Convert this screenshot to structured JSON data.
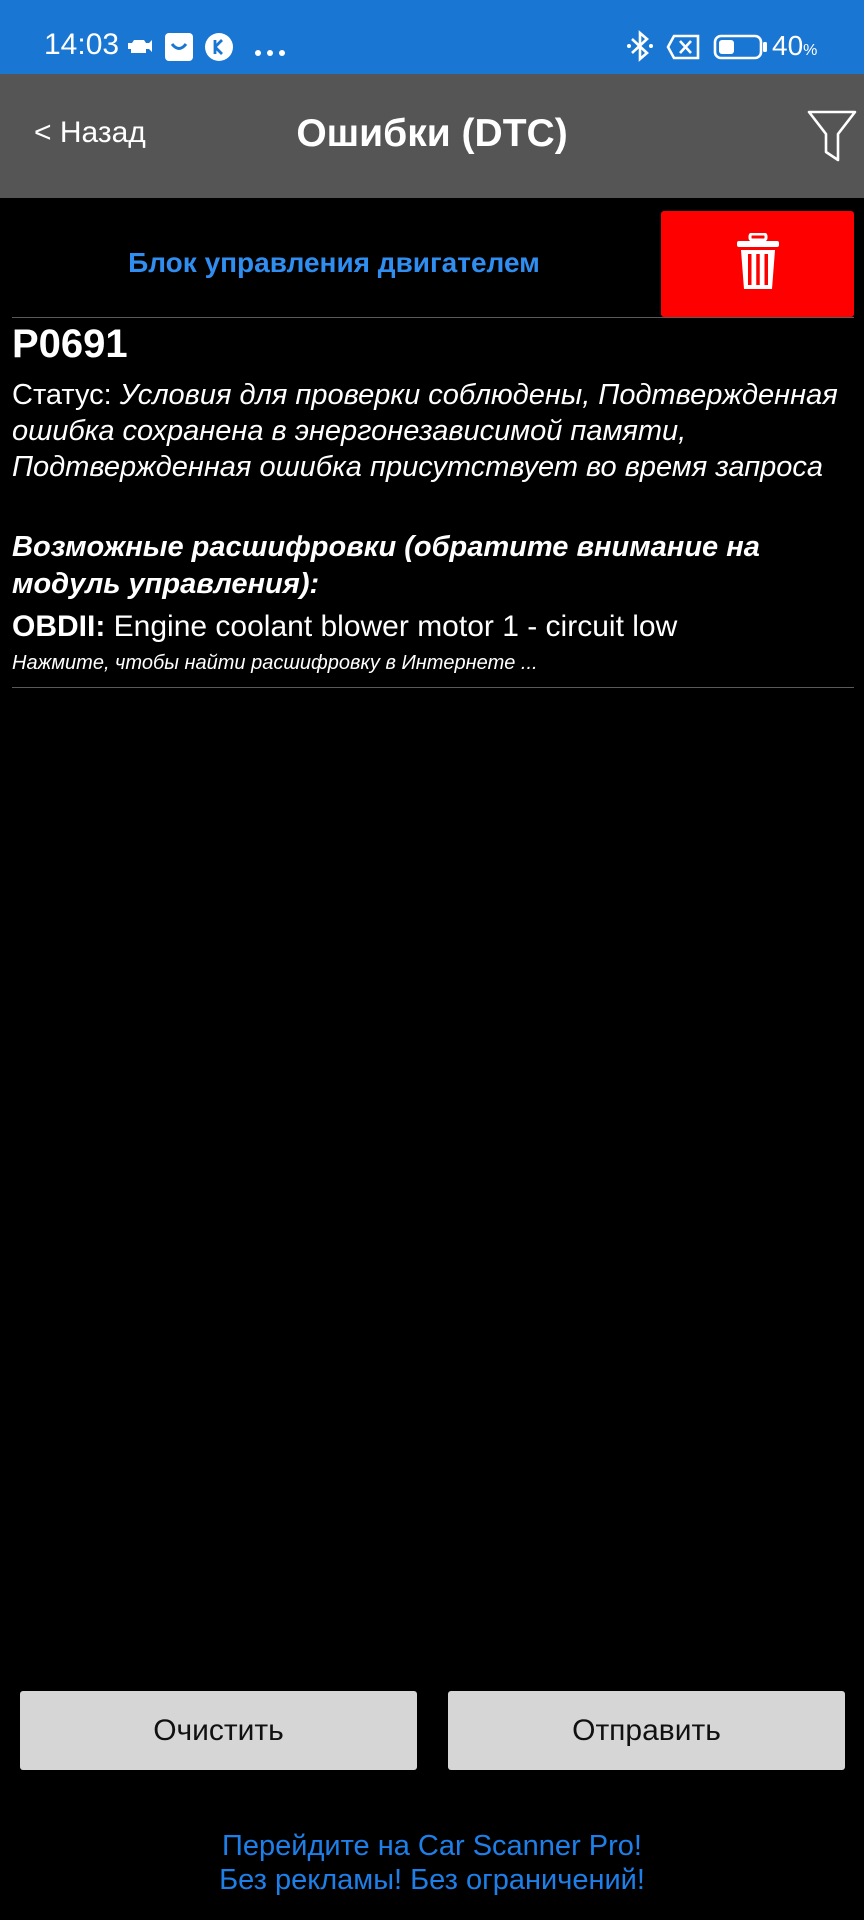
{
  "status_bar": {
    "time": "14:03",
    "battery_percent": "40",
    "battery_unit": "%",
    "battery_level": 0.4,
    "icons": [
      "car-icon",
      "message-app-icon",
      "k-app-icon",
      "more-dots-icon",
      "bluetooth-icon",
      "sim-off-icon",
      "battery-icon"
    ]
  },
  "navbar": {
    "back_label": "< Назад",
    "title": "Ошибки (DTC)",
    "filter_icon": "filter-icon"
  },
  "module": {
    "name": "Блок управления двигателем",
    "delete_icon": "trash-icon",
    "delete_color": "#ff0000"
  },
  "dtc": {
    "code": "P0691",
    "status_label": "Статус: ",
    "status_value": "Условия для проверки соблюдены, Подтвержденная ошибка сохранена в энергонезависимой памяти, Подтвержденная ошибка присутствует во время запроса",
    "decode_title": "Возможные расшифровки (обратите внимание на модуль управления):",
    "obd_label": "OBDII:",
    "obd_text": " Engine coolant blower motor 1 - circuit low",
    "search_hint": "Нажмите, чтобы найти расшифровку в Интернете ..."
  },
  "buttons": {
    "clear": "Очистить",
    "send": "Отправить"
  },
  "promo": {
    "line1": "Перейдите на Car Scanner Pro!",
    "line2": "Без рекламы! Без ограничений!"
  },
  "colors": {
    "status_bar": "#1976d2",
    "navbar": "#555555",
    "accent": "#2f8ef0",
    "button": "#d6d6d6"
  }
}
